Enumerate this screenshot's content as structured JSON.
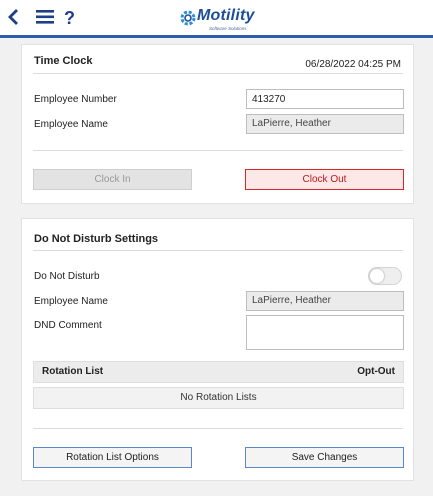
{
  "header": {
    "back_icon": "chevron-left-icon",
    "menu_icon": "hamburger-menu-icon",
    "help_icon": "?",
    "logo": {
      "name": "Motility",
      "tagline": "Software Solutions"
    },
    "accent_color": "#2a5fa8"
  },
  "time_clock": {
    "title": "Time Clock",
    "datetime": "06/28/2022 04:25 PM",
    "employee_number_label": "Employee Number",
    "employee_number_value": "413270",
    "employee_name_label": "Employee Name",
    "employee_name_value": "LaPierre, Heather",
    "clock_in_label": "Clock In",
    "clock_out_label": "Clock Out",
    "clock_in_enabled": false,
    "clock_out_color": "#d9262b"
  },
  "dnd": {
    "title": "Do Not Disturb Settings",
    "toggle_label": "Do Not Disturb",
    "toggle_on": false,
    "employee_name_label": "Employee Name",
    "employee_name_value": "LaPierre, Heather",
    "comment_label": "DND Comment",
    "comment_value": "",
    "rotation_list": {
      "column_name": "Rotation List",
      "column_optout": "Opt-Out",
      "empty_text": "No Rotation Lists"
    },
    "rotation_options_label": "Rotation List Options",
    "save_label": "Save Changes"
  }
}
